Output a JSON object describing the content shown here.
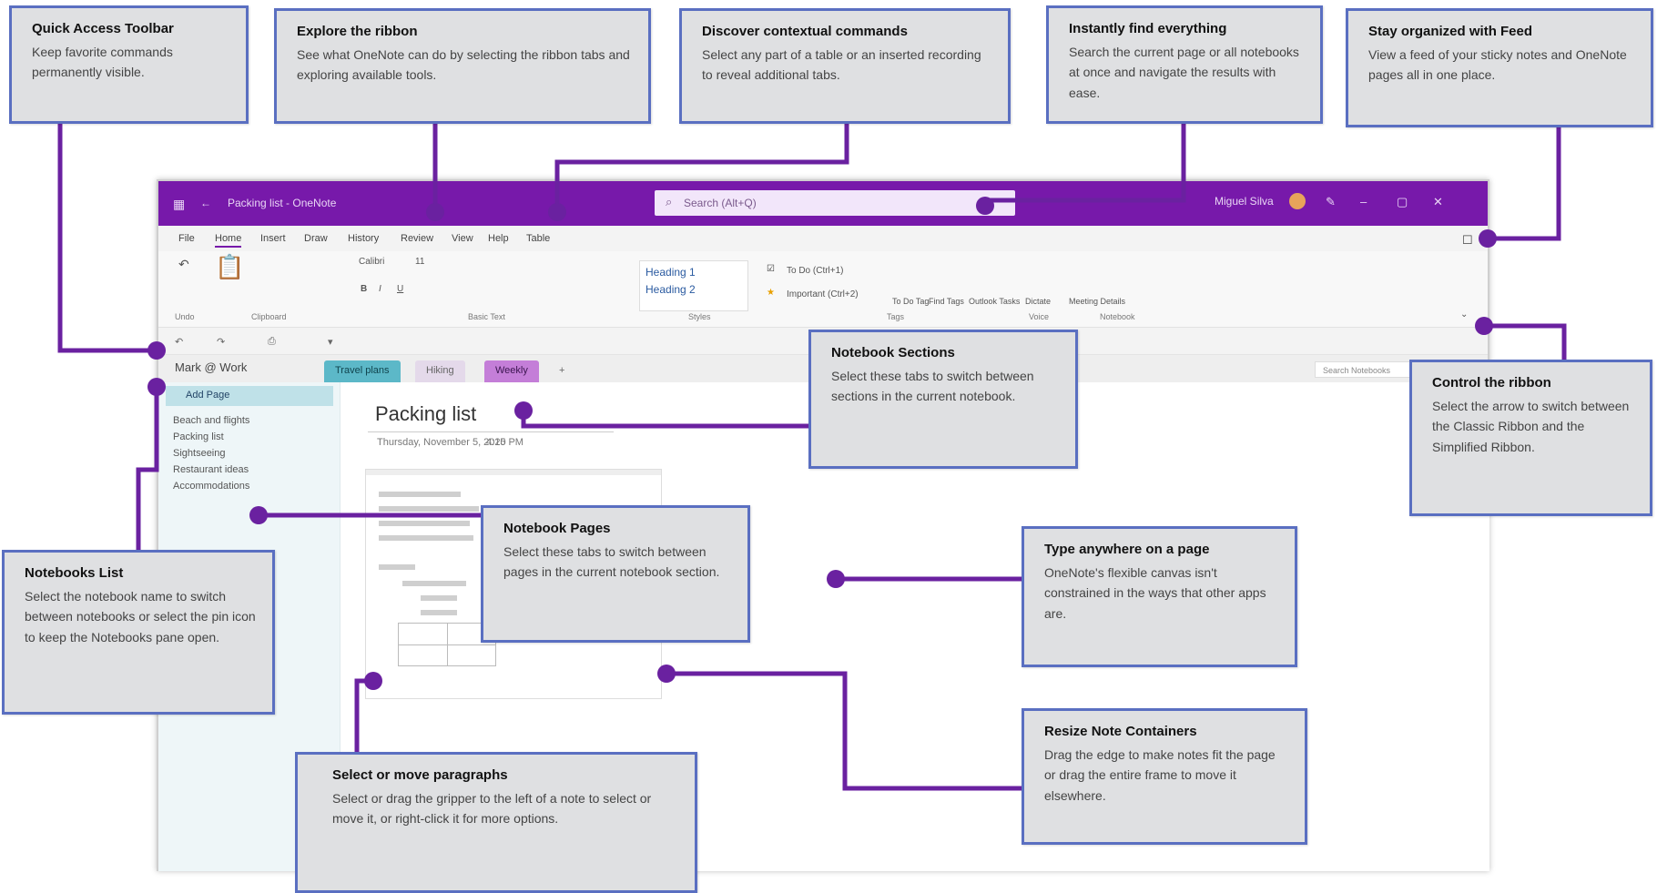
{
  "app": {
    "title": "Packing list - OneNote",
    "search_placeholder": "Search (Alt+Q)",
    "user": "Miguel Silva",
    "menu_tabs": [
      "File",
      "Home",
      "Insert",
      "Draw",
      "History",
      "Review",
      "View",
      "Help",
      "Table"
    ],
    "ribbon": {
      "groups": [
        "Undo",
        "Clipboard",
        "Basic Text",
        "Styles",
        "Tags",
        "Voice",
        "Notebook"
      ],
      "font": "Calibri",
      "size": "11",
      "styles": [
        "Heading 1",
        "Heading 2"
      ],
      "tags": [
        "To Do (Ctrl+1)",
        "Important (Ctrl+2)"
      ],
      "buttons": [
        "To Do Tag",
        "Find Tags",
        "Outlook Tasks",
        "Dictate",
        "Meeting Details"
      ]
    },
    "notebook": "Mark @ Work",
    "sections": [
      "Travel plans",
      "Hiking",
      "Weekly"
    ],
    "search_notebooks": "Search Notebooks",
    "add_page": "Add Page",
    "pages": [
      "Beach and flights",
      "Packing list",
      "Sightseeing",
      "Restaurant ideas",
      "Accommodations"
    ],
    "page_title": "Packing list",
    "page_date": "Thursday, November 5, 2020",
    "page_time": "4:15 PM"
  },
  "callouts": {
    "qat": {
      "title": "Quick Access Toolbar",
      "text": "Keep favorite commands permanently visible."
    },
    "ribbon": {
      "title": "Explore the ribbon",
      "text": "See what OneNote can do by selecting the ribbon tabs and exploring available tools."
    },
    "contextual": {
      "title": "Discover contextual commands",
      "text": "Select any part of a table or an inserted recording to reveal additional tabs."
    },
    "find": {
      "title": "Instantly find everything",
      "text": "Search the current page or all notebooks at once and navigate the results with ease."
    },
    "feed": {
      "title": "Stay organized with Feed",
      "text": "View a feed of your sticky notes and OneNote pages all in one place."
    },
    "sections": {
      "title": "Notebook Sections",
      "text": "Select these tabs to switch between sections in the current notebook."
    },
    "control": {
      "title": "Control the ribbon",
      "text": "Select the arrow to switch between the Classic Ribbon and the Simplified Ribbon."
    },
    "notebooks": {
      "title": "Notebooks List",
      "text": "Select the notebook name to switch between notebooks or select the pin icon to keep the Notebooks pane open."
    },
    "pages": {
      "title": "Notebook Pages",
      "text": "Select these tabs to switch between pages in the current notebook section."
    },
    "type": {
      "title": "Type anywhere on a page",
      "text": "OneNote's flexible canvas isn't constrained in the ways that other apps are."
    },
    "resize": {
      "title": "Resize Note Containers",
      "text": "Drag the edge to make notes fit the page or drag the entire frame to move it elsewhere."
    },
    "paragraphs": {
      "title": "Select or move paragraphs",
      "text": "Select or drag the gripper to the left of a note to select or move it, or right-click it for more options."
    }
  },
  "colors": {
    "accent": "#7719aa",
    "callout_border": "#5a6fc1",
    "callout_bg": "#dfe0e2",
    "connector": "#6a21a0"
  }
}
